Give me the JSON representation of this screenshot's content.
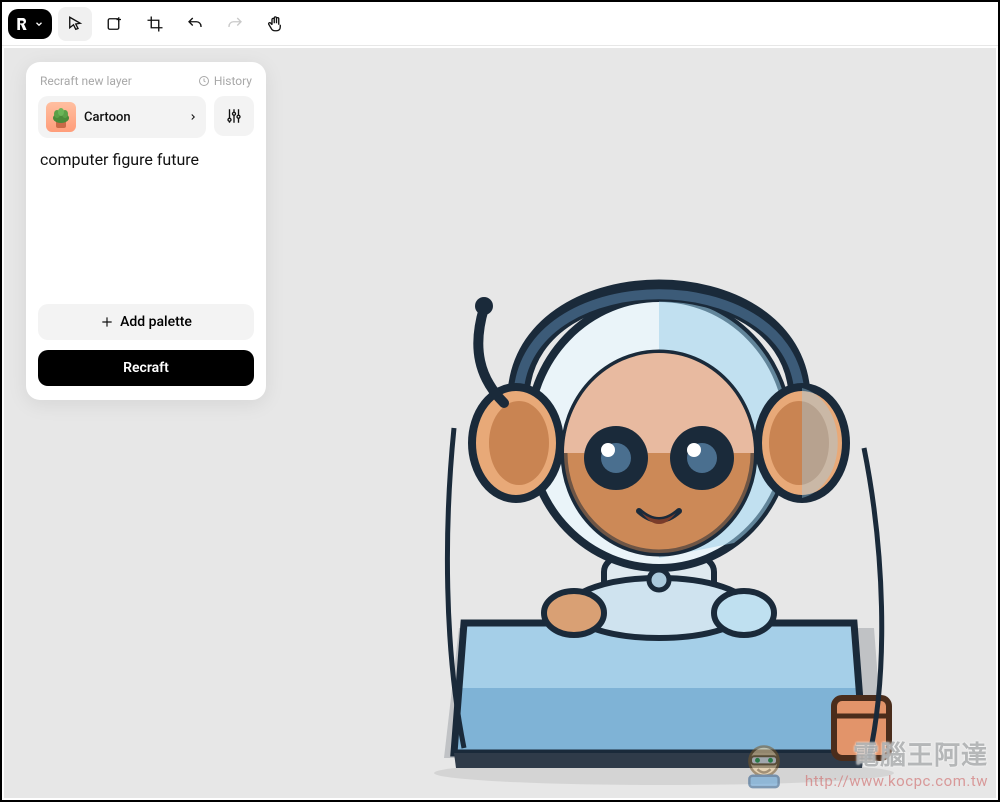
{
  "toolbar": {
    "logo_label": "R"
  },
  "panel": {
    "title": "Recraft new layer",
    "history_label": "History",
    "style_label": "Cartoon",
    "prompt": "computer figure future",
    "add_palette_label": "Add palette",
    "recraft_label": "Recraft"
  },
  "watermark": {
    "title": "電腦王阿達",
    "url": "http://www.kocpc.com.tw"
  }
}
